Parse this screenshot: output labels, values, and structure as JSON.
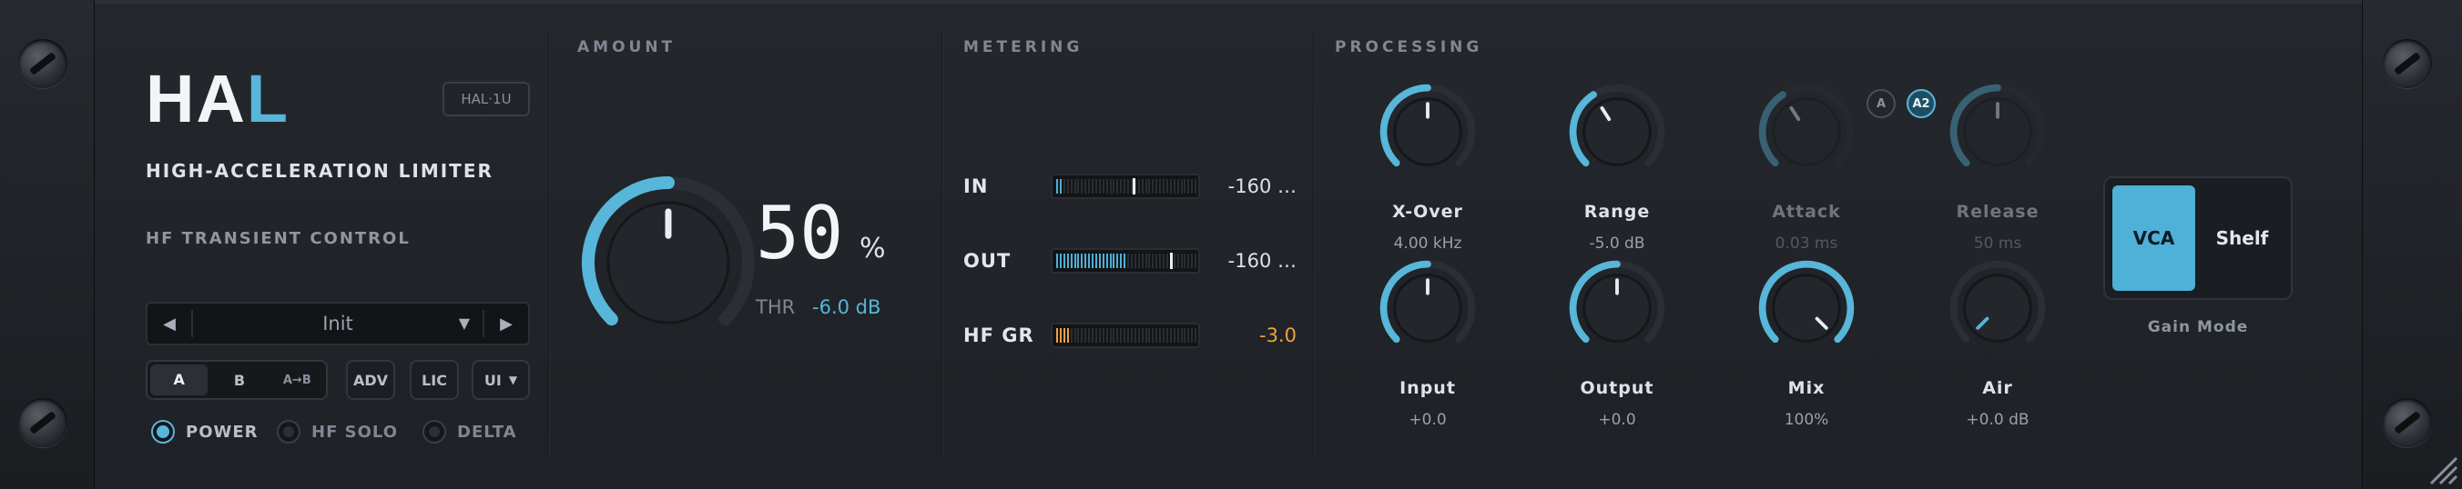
{
  "brand": {
    "logo_a": "HA",
    "logo_b": "L",
    "model_badge": "HAL·1U",
    "subtitle": "HIGH-ACCELERATION LIMITER",
    "tagline": "HF TRANSIENT CONTROL"
  },
  "sections": {
    "amount": "AMOUNT",
    "metering": "METERING",
    "processing": "PROCESSING"
  },
  "preset": {
    "prev": "◀",
    "name": "Init",
    "caret": "▼",
    "next": "▶"
  },
  "ab": {
    "a": "A",
    "b": "B",
    "copy": "A→B"
  },
  "buttons": {
    "adv": "ADV",
    "lic": "LIC",
    "ui": "UI",
    "ui_caret": "▼"
  },
  "toggles": {
    "power": "POWER",
    "hf_solo": "HF SOLO",
    "delta": "DELTA",
    "power_on": true,
    "hf_solo_on": false,
    "delta_on": false
  },
  "amount": {
    "value": "50",
    "unit": "%",
    "thr_label": "THR",
    "thr_value": "-6.0 dB",
    "level": 0.5
  },
  "meters": [
    {
      "label": "IN",
      "value": "-160 …",
      "level": 0.03,
      "peak": 0.55,
      "color": "#4fb0d8"
    },
    {
      "label": "OUT",
      "value": "-160 …",
      "level": 0.5,
      "peak": 0.82,
      "color": "#4fb0d8"
    },
    {
      "label": "HF GR",
      "value": "-3.0",
      "level": 0.08,
      "peak": 0,
      "color": "#f0a040"
    }
  ],
  "ab_mode": {
    "a": "A",
    "a2": "A2"
  },
  "knobs": [
    {
      "label": "X-Over",
      "value": "4.00 kHz",
      "level": 0.5,
      "dim": false
    },
    {
      "label": "Range",
      "value": "-5.0 dB",
      "level": 0.38,
      "dim": false
    },
    {
      "label": "Attack",
      "value": "0.03 ms",
      "level": 0.38,
      "dim": true
    },
    {
      "label": "Release",
      "value": "50 ms",
      "level": 0.5,
      "dim": true
    },
    {
      "label": "Input",
      "value": "+0.0",
      "level": 0.5,
      "dim": false
    },
    {
      "label": "Output",
      "value": "+0.0",
      "level": 0.5,
      "dim": false
    },
    {
      "label": "Mix",
      "value": "100%",
      "level": 1.0,
      "dim": false
    },
    {
      "label": "Air",
      "value": "+0.0 dB",
      "level": 0.0,
      "dim": false
    }
  ],
  "gain_mode": {
    "vca": "VCA",
    "shelf": "Shelf",
    "label": "Gain Mode"
  },
  "colors": {
    "accent": "#57b6d9",
    "gr": "#f0a040",
    "bg": "#1e2125"
  }
}
